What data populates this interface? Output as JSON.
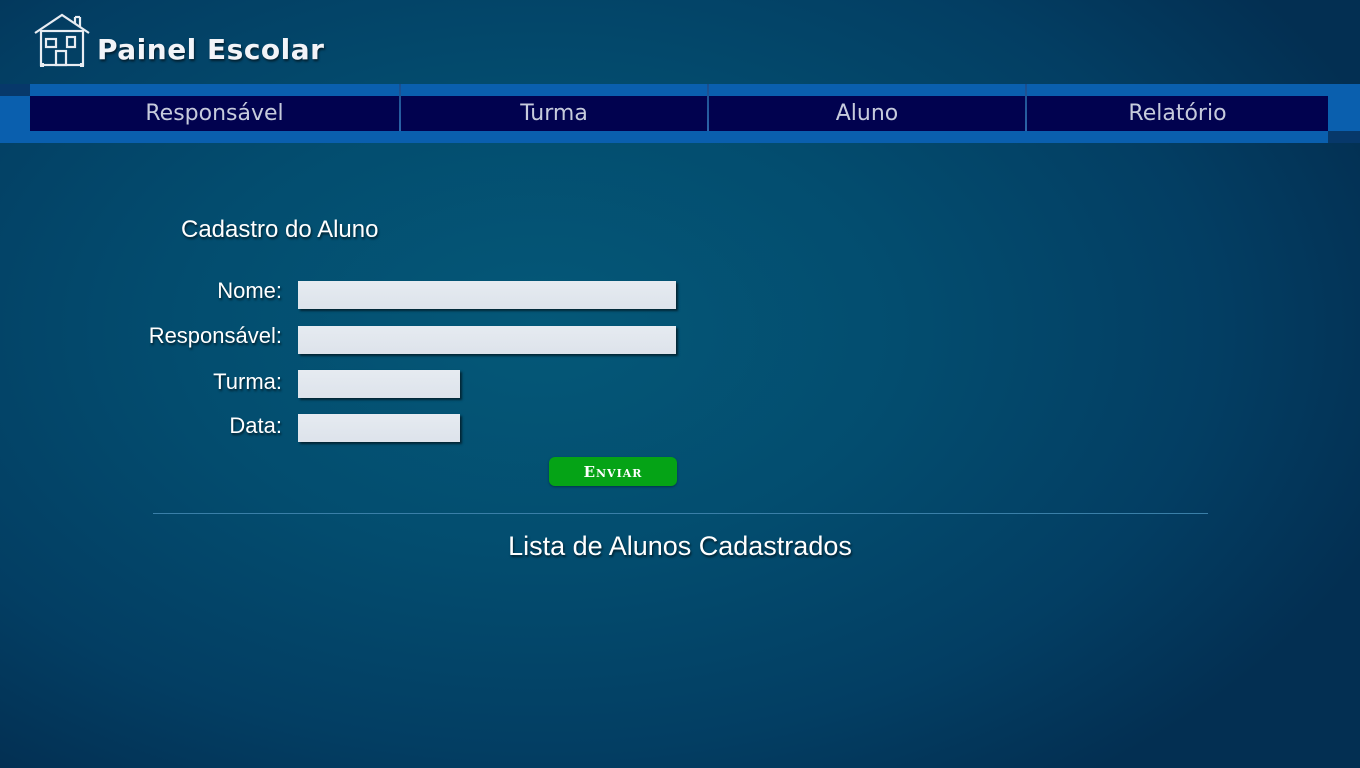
{
  "header": {
    "app_title": "Painel Escolar",
    "logo_icon": "house-icon"
  },
  "nav": {
    "items": [
      {
        "label": "Responsável"
      },
      {
        "label": "Turma"
      },
      {
        "label": "Aluno"
      },
      {
        "label": "Relatório"
      }
    ]
  },
  "form": {
    "title": "Cadastro do Aluno",
    "fields": {
      "nome": {
        "label": "Nome:",
        "value": ""
      },
      "responsavel": {
        "label": "Responsável:",
        "value": ""
      },
      "turma": {
        "label": "Turma:",
        "value": ""
      },
      "data": {
        "label": "Data:",
        "value": ""
      }
    },
    "submit_label": "Enviar"
  },
  "list": {
    "title": "Lista de Alunos Cadastrados"
  },
  "colors": {
    "background": "#034d6f",
    "nav_bar": "#0a5fae",
    "nav_inner": "#01024f",
    "submit_button": "#05a316",
    "input_background": "#e6ebf1"
  }
}
